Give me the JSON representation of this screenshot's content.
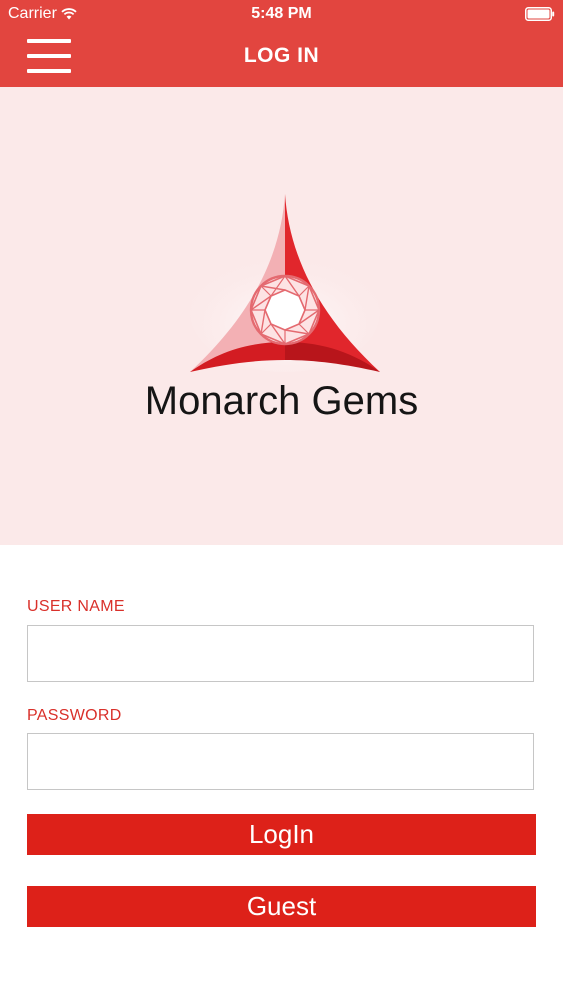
{
  "status_bar": {
    "carrier": "Carrier",
    "time": "5:48 PM",
    "wifi_icon": "wifi-icon",
    "battery_icon": "battery-icon"
  },
  "nav": {
    "title": "LOG IN",
    "menu_icon": "hamburger-menu-icon"
  },
  "logo": {
    "brand_name": "Monarch Gems",
    "mark_icon": "gem-triangle-logo"
  },
  "form": {
    "username": {
      "label": "USER NAME",
      "value": "",
      "placeholder": ""
    },
    "password": {
      "label": "PASSWORD",
      "value": "",
      "placeholder": ""
    },
    "login_label": "LogIn",
    "guest_label": "Guest"
  },
  "colors": {
    "header": "#e2453f",
    "banner": "#fbe9e9",
    "accent": "#dd2119",
    "label": "#d9302a"
  }
}
